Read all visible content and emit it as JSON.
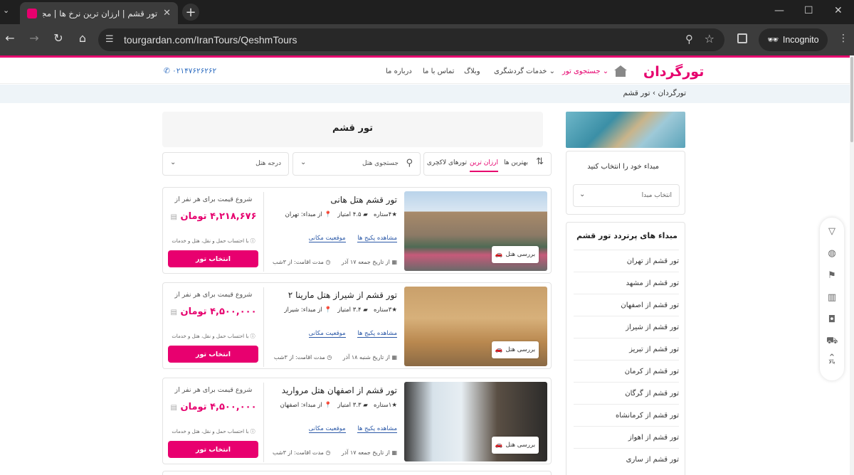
{
  "browser": {
    "tab_title": "تور قشم | ارزان ترین نرخ ها | مجری",
    "url": "tourgardan.com/IranTours/QeshmTours",
    "incognito_label": "Incognito"
  },
  "site": {
    "logo": "تورگردان",
    "nav": {
      "search_tour": "جستجوی تور",
      "tourism_services": "خدمات گردشگری",
      "blog": "وبلاگ",
      "contact": "تماس با ما",
      "about": "درباره ما"
    },
    "phone": "۰۲۱۴۷۶۲۶۲۶۲",
    "breadcrumb": "تورگردان › تور قشم"
  },
  "sidebar": {
    "origin_label": "مبداء خود را انتخاب کنید",
    "origin_select": "انتخاب مبدا",
    "popular_title": "مبداء های پرتردد تور قشم",
    "popular": [
      "تور قشم از تهران",
      "تور قشم از مشهد",
      "تور قشم از اصفهان",
      "تور قشم از شیراز",
      "تور قشم از تبریز",
      "تور قشم از کرمان",
      "تور قشم از گرگان",
      "تور قشم از کرمانشاه",
      "تور قشم از اهواز",
      "تور قشم از ساری"
    ]
  },
  "main": {
    "title": "تور قشم",
    "sort": {
      "best": "بهترین ها",
      "cheapest": "ارزان ترین",
      "luxury": "تورهای لاکچری"
    },
    "hotel_search": "جستجوی هتل",
    "hotel_grade": "درجه هتل",
    "tours": [
      {
        "name": "تور قشم هتل هانی",
        "stars": "۴ستاره",
        "score": "۴.۵ امتیاز",
        "origin": "از مبداء: تهران",
        "packages_link": "مشاهده پکیج ها",
        "location_link": "موقعیت مکانی",
        "date": "از تاریخ جمعه ۱۷ آذر",
        "stay": "مدت اقامت: از ۳شب",
        "price_from": "شروع قیمت برای هر نفر از",
        "price": "۴,۲۱۸,۶۷۶ تومان",
        "note": "با احتساب حمل و نقل، هتل و خدمات",
        "button": "انتخاب تور",
        "review": "بررسی هتل"
      },
      {
        "name": "تور قشم از شیراز هتل مارینا ۲",
        "stars": "۳ستاره",
        "score": "۳.۴ امتیاز",
        "origin": "از مبداء: شیراز",
        "packages_link": "مشاهده پکیج ها",
        "location_link": "موقعیت مکانی",
        "date": "از تاریخ شنبه ۱۸ آذر",
        "stay": "مدت اقامت: از ۳شب",
        "price_from": "شروع قیمت برای هر نفر از",
        "price": "۴,۵۰۰,۰۰۰ تومان",
        "note": "با احتساب حمل و نقل، هتل و خدمات",
        "button": "انتخاب تور",
        "review": "بررسی هتل"
      },
      {
        "name": "تور قشم از اصفهان هتل مروارید",
        "stars": "۱ستاره",
        "score": "۳.۳ امتیاز",
        "origin": "از مبداء: اصفهان",
        "packages_link": "مشاهده پکیج ها",
        "location_link": "موقعیت مکانی",
        "date": "از تاریخ جمعه ۱۷ آذر",
        "stay": "مدت اقامت: از ۳شب",
        "price_from": "شروع قیمت برای هر نفر از",
        "price": "۴,۵۰۰,۰۰۰ تومان",
        "note": "با احتساب حمل و نقل، هتل و خدمات",
        "button": "انتخاب تور",
        "review": "بررسی هتل"
      }
    ]
  },
  "floatbar": {
    "up_label": "بالا",
    "icons": [
      "filter-icon",
      "globe-icon",
      "signpost-icon",
      "building-icon",
      "camera-icon",
      "car-icon",
      "chevron-up-icon"
    ]
  },
  "colors": {
    "brand": "#e6006e",
    "link": "#2d5aa8"
  }
}
